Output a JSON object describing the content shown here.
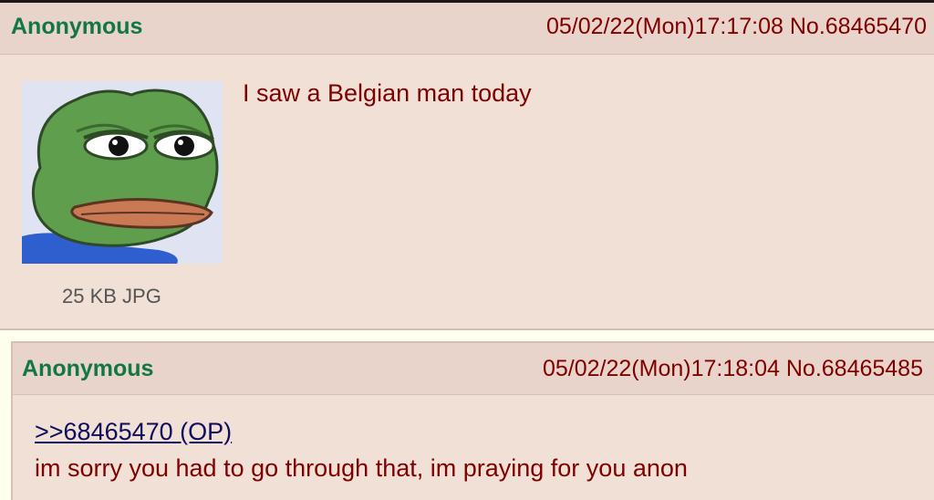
{
  "posts": [
    {
      "name": "Anonymous",
      "datetime": "05/02/22(Mon)17:17:08",
      "number": "No.68465470",
      "file": {
        "info": "25 KB JPG",
        "image": "pepe-frog-thumbnail"
      },
      "message": "I saw a Belgian man today"
    },
    {
      "name": "Anonymous",
      "datetime": "05/02/22(Mon)17:18:04",
      "number": "No.68465485",
      "quote": ">>68465470 (OP)",
      "message": "im sorry you had to go through that, im praying for you anon"
    }
  ],
  "colors": {
    "post_bg": "#f0e0d6",
    "name": "#117743",
    "text": "#800000",
    "quote_link": "#0f0c5d"
  }
}
